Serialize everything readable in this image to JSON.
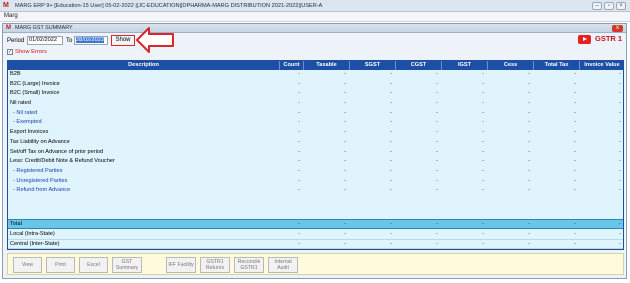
{
  "app": {
    "logo": "M",
    "title": "MARG ERP 9+ [Education-15 User] 05-02-2022 ||JC-EDUCATION||DPHARMA-MARG DISTRIBUTION 2021-2022||USER-A",
    "menu": [
      "Marg"
    ]
  },
  "window": {
    "title": "MARG GST SUMMARY",
    "close": "x"
  },
  "filters": {
    "period_label": "Period",
    "from_date": "01/02/2022",
    "to_label": "To",
    "to_date": "28/02/2022",
    "show_button": "Show",
    "show_errors_label": "Show Errors",
    "show_errors_checked": true
  },
  "badge": {
    "gstr_label": "GSTR 1",
    "youtube_icon": "youtube-icon"
  },
  "table": {
    "columns": [
      "Description",
      "Count",
      "Taxable",
      "SGST",
      "CGST",
      "IGST",
      "Cess",
      "Total Tax",
      "Invoice Value"
    ],
    "rows": [
      {
        "desc": "B2B",
        "sub": false
      },
      {
        "desc": "B2C (Large) Invoice",
        "sub": false
      },
      {
        "desc": "B2C (Small) Invoice",
        "sub": false
      },
      {
        "desc": "Nil rated",
        "sub": false
      },
      {
        "desc": "- Nil rated",
        "sub": true
      },
      {
        "desc": "- Exempted",
        "sub": true
      },
      {
        "desc": "Export Invoices",
        "sub": false
      },
      {
        "desc": "Tax Liability on Advance",
        "sub": false
      },
      {
        "desc": "Set/off Tax on Advance of prior period",
        "sub": false
      },
      {
        "desc": "Less: Credit/Debit Note & Refund Voucher",
        "sub": false
      },
      {
        "desc": "- Registered Parties",
        "sub": true
      },
      {
        "desc": "- Unregistered Parties",
        "sub": true
      },
      {
        "desc": "- Refund from Advance",
        "sub": true
      }
    ],
    "empty_value": "-",
    "total_label": "Total",
    "bottom_rows": [
      "Local (Intra-State)",
      "Central (Inter-State)"
    ]
  },
  "buttons": [
    "View",
    "Print",
    "Excel",
    "GST Summary",
    "IFF Facility",
    "GSTR1 Returns",
    "Reconcile GSTR1",
    "Internal Audit"
  ]
}
